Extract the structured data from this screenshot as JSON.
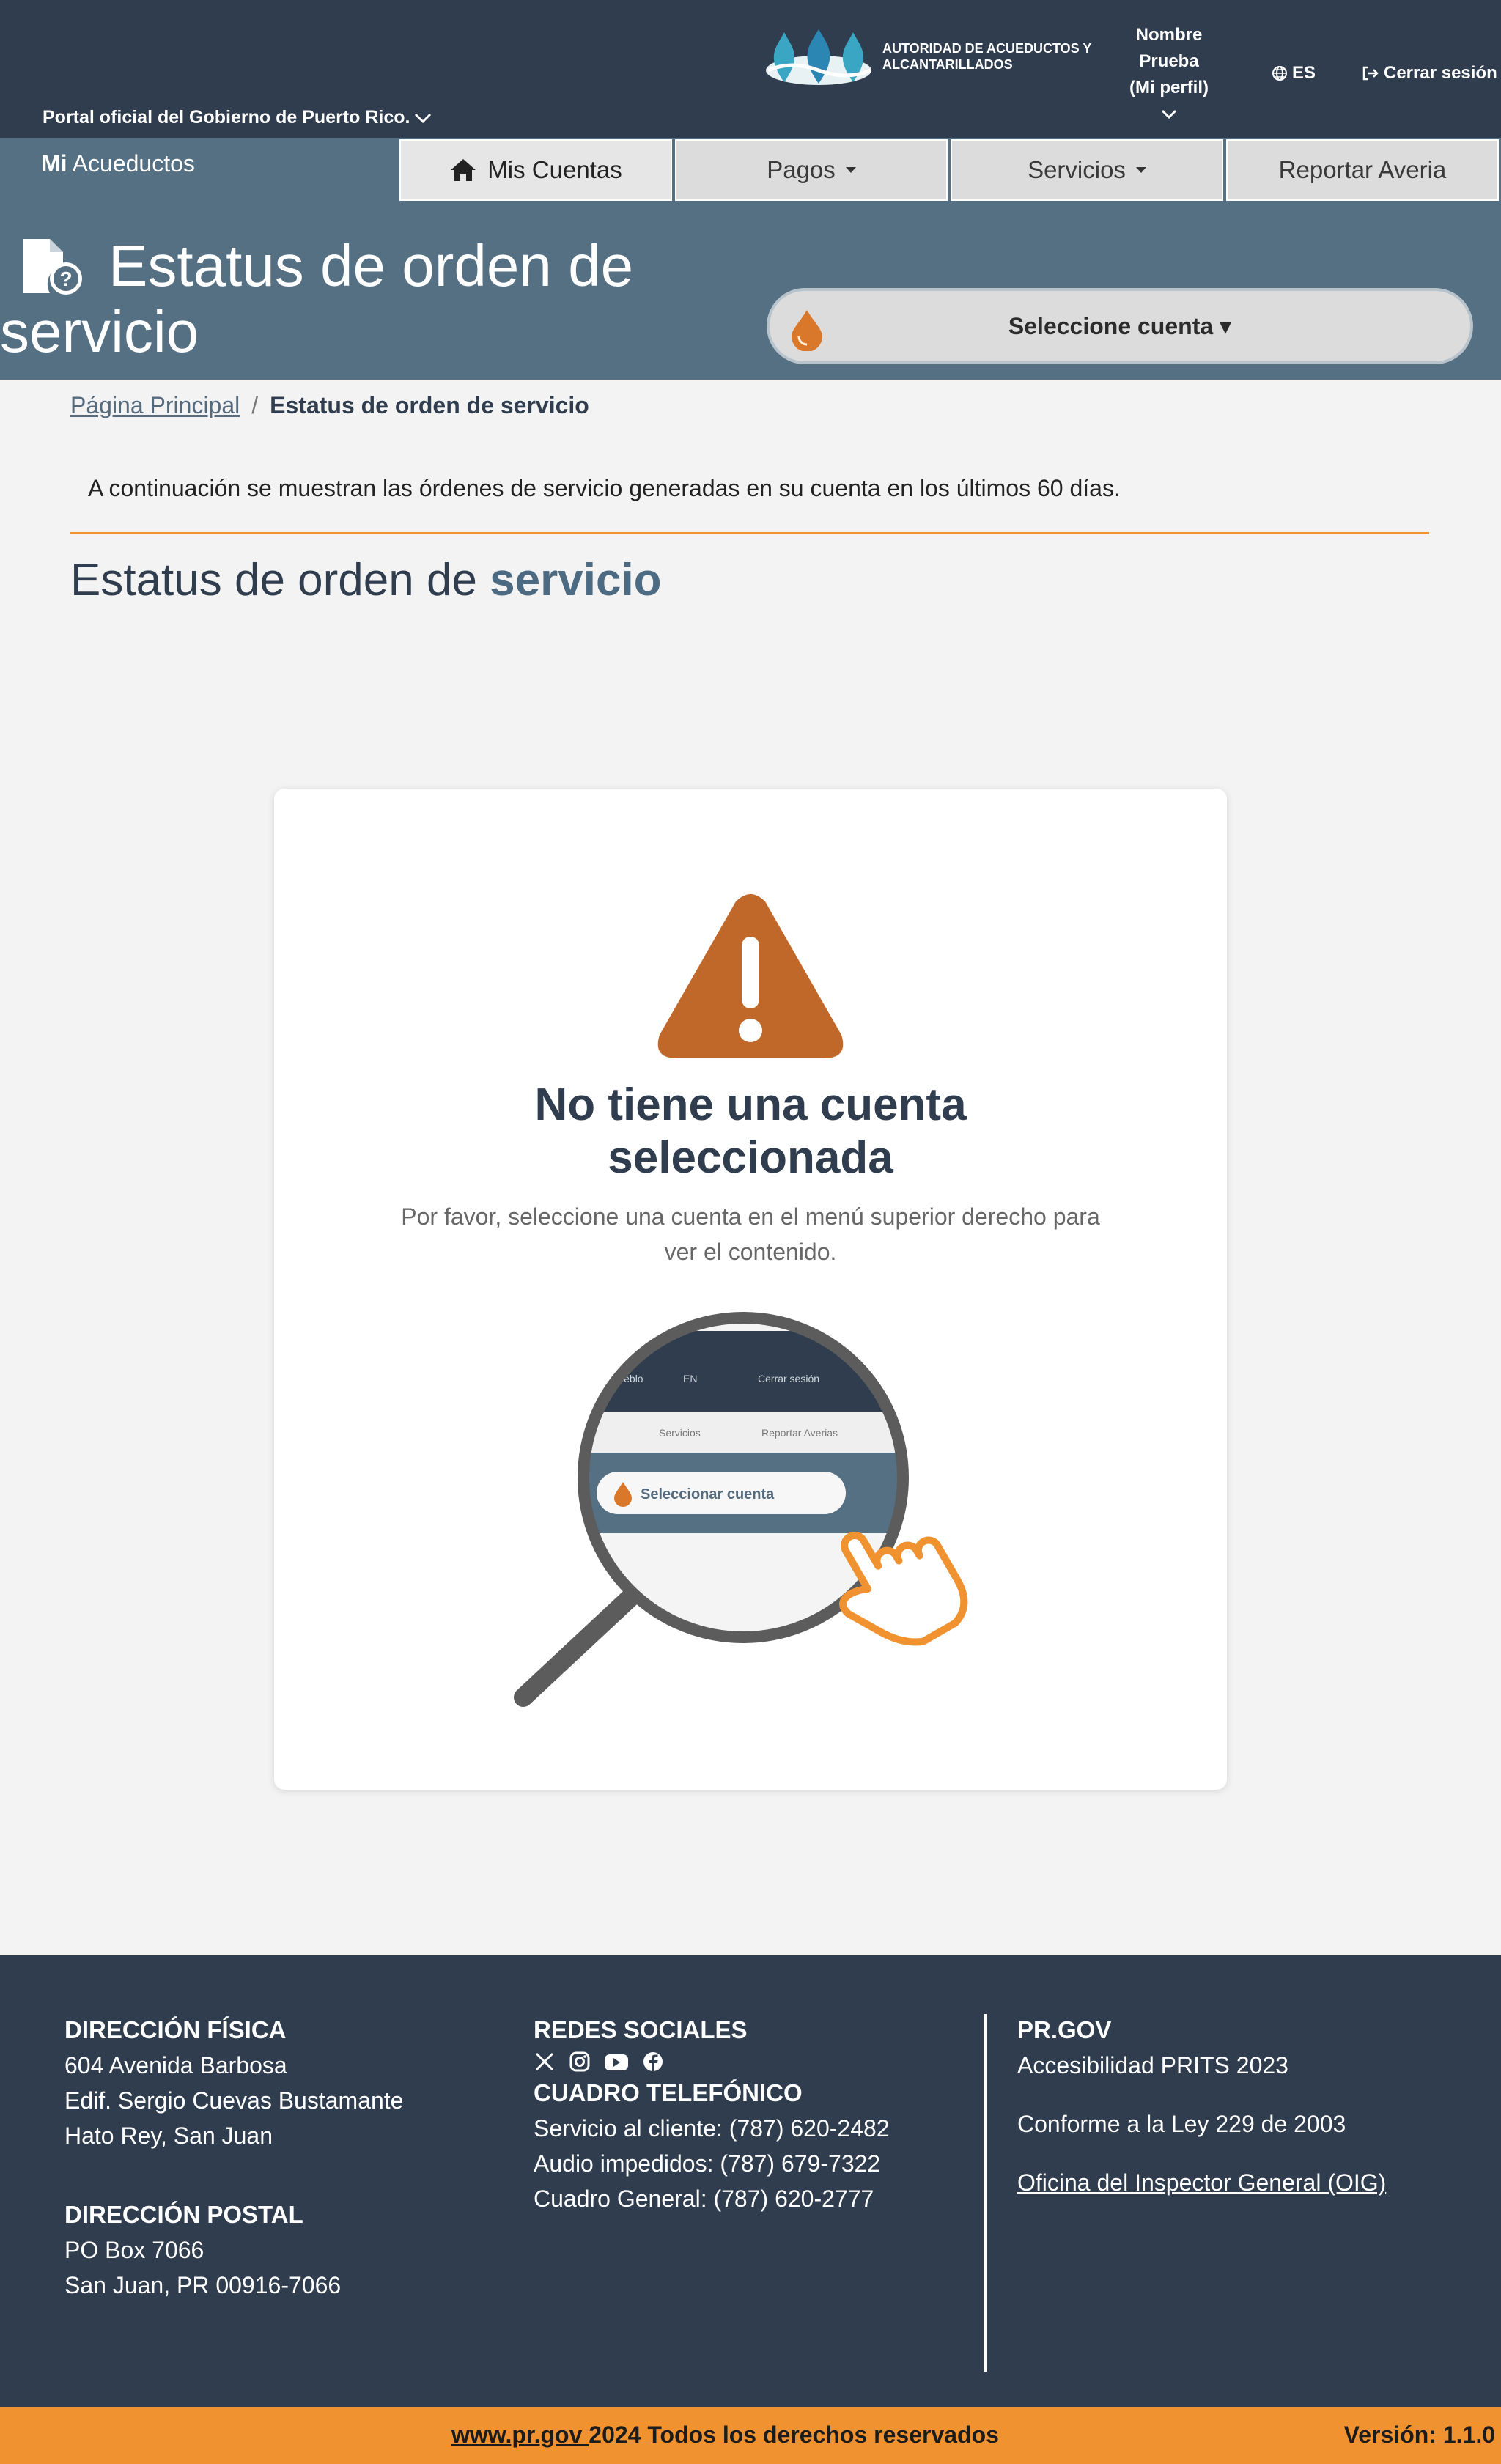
{
  "header": {
    "gov_link": "Portal oficial del Gobierno de Puerto Rico.",
    "logo_text": "AUTORIDAD DE ACUEDUCTOS Y ALCANTARILLADOS",
    "profile_lines": [
      "Nombre",
      "Prueba",
      "(Mi perfil)"
    ],
    "lang": "ES",
    "logout": "Cerrar sesión"
  },
  "brand": {
    "bold": "Mi",
    "rest": " Acueductos"
  },
  "nav": {
    "tabs": [
      "Mis Cuentas",
      "Pagos",
      "Servicios",
      "Reportar Averia"
    ]
  },
  "page": {
    "title": "Estatus de orden de servicio",
    "account_select": "Seleccione cuenta ▾"
  },
  "breadcrumb": {
    "home": "Página Principal",
    "sep": "/",
    "current": "Estatus de orden de servicio"
  },
  "intro": "A continuación se muestran las órdenes de servicio generadas en su cuenta en los últimos 60 días.",
  "section": {
    "prefix": "Estatus de orden de ",
    "emphasis": "servicio"
  },
  "empty_state": {
    "title_line1": "No tiene una cuenta",
    "title_line2": "seleccionada",
    "text": "Por favor, seleccione una cuenta en el menú superior derecho para ver el contenido.",
    "illustration": {
      "menu_items": [
        "Pueblo",
        "EN",
        "Cerrar sesión",
        "Servicios",
        "Reportar Averias"
      ],
      "select_label": "Seleccionar cuenta"
    }
  },
  "footer": {
    "fisica_title": "DIRECCIÓN FÍSICA",
    "fisica_lines": [
      "604 Avenida Barbosa",
      "Edif. Sergio Cuevas Bustamante",
      "Hato Rey, San Juan"
    ],
    "postal_title": "DIRECCIÓN POSTAL",
    "postal_lines": [
      "PO Box 7066",
      "San Juan, PR 00916-7066"
    ],
    "redes_title": "REDES SOCIALES",
    "cuadro_title": "CUADRO TELEFÓNICO",
    "phones": [
      "Servicio al cliente: (787) 620-2482",
      "Audio impedidos: (787) 679-7322",
      "Cuadro General: (787) 620-2777"
    ],
    "prgov_title": "PR.GOV",
    "accesibilidad": "Accesibilidad PRITS 2023",
    "ley": "Conforme a la Ley 229 de 2003",
    "oig": "Oficina del Inspector General (OIG)"
  },
  "bottom": {
    "link": "www.pr.gov ",
    "rest": "2024 Todos los derechos reservados",
    "version": "Versión: 1.1.0"
  },
  "colors": {
    "navy": "#2f3d4e",
    "steel": "#557083",
    "orange": "#f0922f",
    "warning": "#c0672a"
  }
}
